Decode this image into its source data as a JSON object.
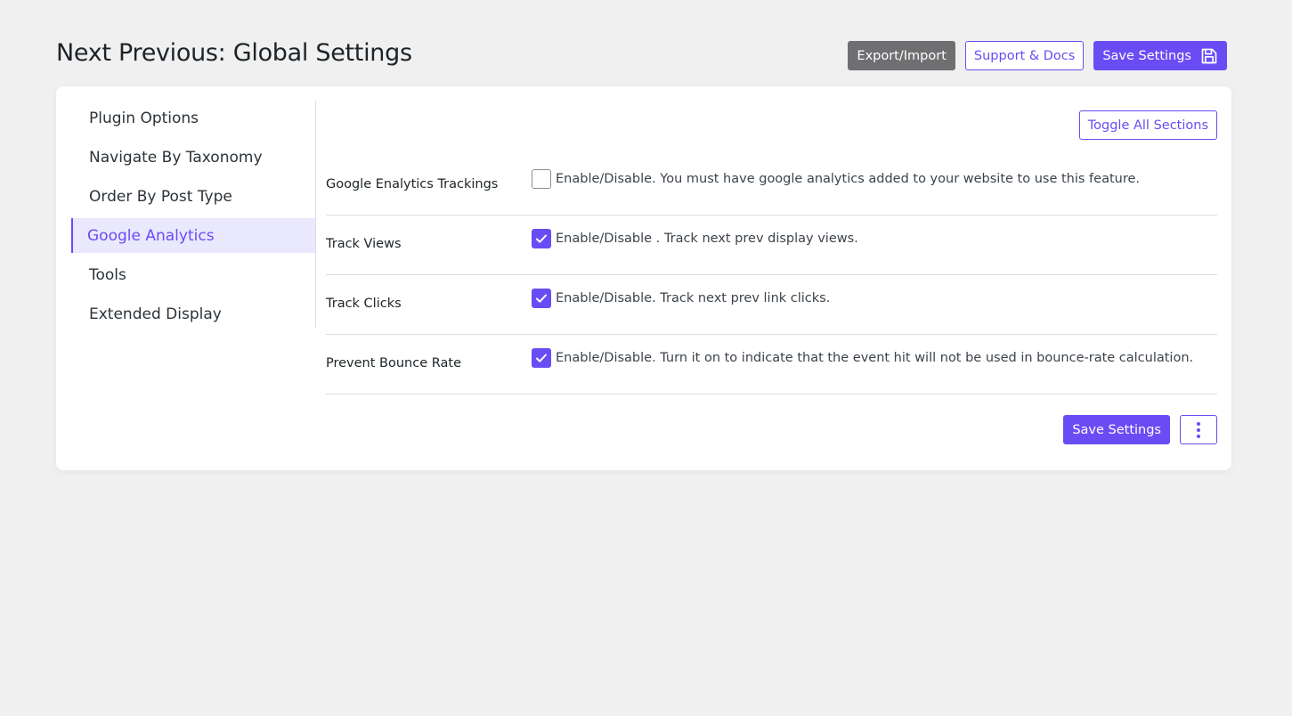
{
  "header": {
    "title": "Next Previous: Global Settings",
    "export_import_label": "Export/Import",
    "support_docs_label": "Support & Docs",
    "save_settings_label": "Save Settings"
  },
  "sidebar": {
    "items": [
      {
        "label": "Plugin Options",
        "active": false
      },
      {
        "label": "Navigate By Taxonomy",
        "active": false
      },
      {
        "label": "Order By Post Type",
        "active": false
      },
      {
        "label": "Google Analytics",
        "active": true
      },
      {
        "label": "Tools",
        "active": false
      },
      {
        "label": "Extended Display",
        "active": false
      }
    ]
  },
  "main": {
    "toggle_all_label": "Toggle All Sections",
    "settings": [
      {
        "label": "Google Enalytics Trackings",
        "checked": false,
        "description": "Enable/Disable. You must have google analytics added to your website to use this feature."
      },
      {
        "label": "Track Views",
        "checked": true,
        "description": "Enable/Disable . Track next prev display views."
      },
      {
        "label": "Track Clicks",
        "checked": true,
        "description": "Enable/Disable. Track next prev link clicks."
      },
      {
        "label": "Prevent Bounce Rate",
        "checked": true,
        "description": "Enable/Disable. Turn it on to indicate that the event hit will not be used in bounce-rate calculation."
      }
    ],
    "footer_save_label": "Save Settings",
    "more_icon": "vertical-dots-icon"
  },
  "colors": {
    "accent": "#6a4cf4",
    "gray_button": "#6f6f72",
    "background": "#f0f0f1",
    "active_item_bg": "#e9e8fd"
  }
}
